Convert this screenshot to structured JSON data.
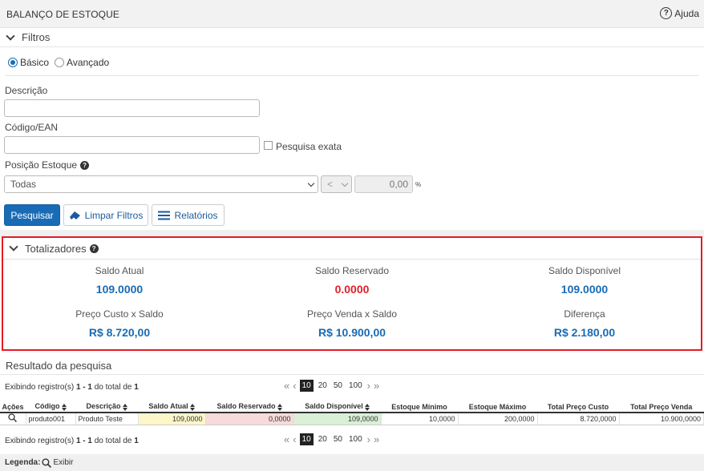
{
  "header": {
    "title": "BALANÇO DE ESTOQUE",
    "help_label": "Ajuda"
  },
  "filters": {
    "section_title": "Filtros",
    "mode_basic": "Básico",
    "mode_advanced": "Avançado",
    "selected_mode": "Básico",
    "description_label": "Descrição",
    "description_value": "",
    "code_label": "Código/EAN",
    "code_value": "",
    "exact_search_label": "Pesquisa exata",
    "stock_position_label": "Posição Estoque",
    "stock_position_value": "Todas",
    "operator_value": "<",
    "percent_value": "0,00",
    "percent_unit": "%",
    "search_button": "Pesquisar",
    "clear_button": "Limpar Filtros",
    "reports_button": "Relatórios"
  },
  "totals": {
    "section_title": "Totalizadores",
    "items": [
      {
        "label": "Saldo Atual",
        "value": "109.0000",
        "color": "#1a6bb5"
      },
      {
        "label": "Saldo Reservado",
        "value": "0.0000",
        "color": "#e0202b"
      },
      {
        "label": "Saldo Disponível",
        "value": "109.0000",
        "color": "#1a6bb5"
      },
      {
        "label": "Preço Custo x Saldo",
        "value": "R$ 8.720,00",
        "color": "#1a6bb5"
      },
      {
        "label": "Preço Venda x Saldo",
        "value": "R$ 10.900,00",
        "color": "#1a6bb5"
      },
      {
        "label": "Diferença",
        "value": "R$ 2.180,00",
        "color": "#1a6bb5"
      }
    ]
  },
  "results": {
    "title": "Resultado da pesquisa",
    "info_prefix": "Exibindo registro(s)",
    "info_range": "1 - 1",
    "info_middle": "do total de",
    "info_total": "1",
    "page_sizes": [
      "10",
      "20",
      "50",
      "100"
    ],
    "current_page_size": "10",
    "columns": [
      "Ações",
      "Código",
      "Descrição",
      "Saldo Atual",
      "Saldo Reservado",
      "Saldo Disponível",
      "Estoque Mínimo",
      "Estoque Máximo",
      "Total Preço Custo",
      "Total Preço Venda"
    ],
    "rows": [
      [
        "produto001",
        "Produto Teste",
        "109,0000",
        "0,0000",
        "109,0000",
        "10,0000",
        "200,0000",
        "8.720,0000",
        "10.900,0000"
      ]
    ]
  },
  "legend": {
    "label": "Legenda:",
    "view_label": "Exibir"
  },
  "colors": {
    "primary": "#1a6bb5",
    "highlight_border": "#e51b24",
    "saldo_atual_bg": "#fdf6c9",
    "saldo_reservado_bg": "#f7dada",
    "saldo_disponivel_bg": "#d9f0d6"
  }
}
